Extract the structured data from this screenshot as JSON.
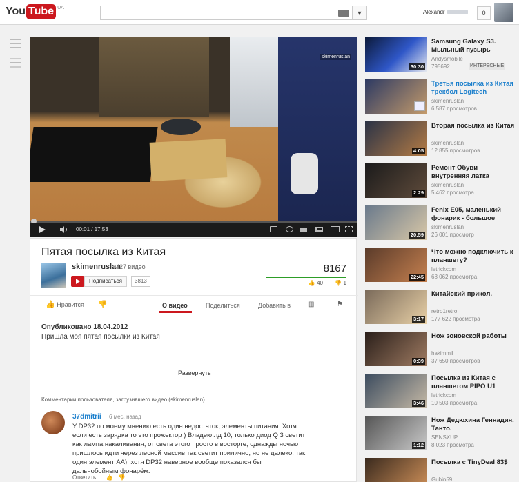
{
  "header": {
    "logo_you": "You",
    "logo_tube": "Tube",
    "logo_region": "UA",
    "search_placeholder": "",
    "user_name": "Alexandr",
    "notifications": "0"
  },
  "player": {
    "watermark": "skimenruslan",
    "time": "00:01 / 17:53",
    "progress_fraction": 0.001
  },
  "video": {
    "title": "Пятая посылка из Китая",
    "channel": "skimenruslan",
    "channel_videos": "427 видео",
    "subscribe_label": "Подписаться",
    "subscribers": "3813",
    "views": "8167",
    "likes": "40",
    "dislikes": "1",
    "actions": {
      "like": "Нравится",
      "about": "О видео",
      "share": "Поделиться",
      "add": "Добавить в"
    },
    "published": "Опубликовано 18.04.2012",
    "description": "Пришла моя пятая посылки из Китая",
    "expand": "Развернуть",
    "comments_header": "Комментарии пользователя, загрузившего видео (skimenruslan)",
    "comment": {
      "author": "37dmitrii",
      "time": "6 мес. назад",
      "text": "У DP32 по моему мнению есть один недостаток, элементы питания. Хотя если есть зарядка то это прожектор ) Владею лд 10, только диод Q 3 светит как лампа накаливания, от света этого просто в восторге, однажды ночью пришлось идти через лесной массив так светит прилично, но не далеко, так один элемент AA), хотя DP32 наверное вообще показался бы дальнобойным фонарём.",
      "reply": "Ответить"
    }
  },
  "related": [
    {
      "title": "Samsung Galaxy S3. Мыльный пузырь",
      "channel": "Andysmobile",
      "views": "795692",
      "duration": "30:30",
      "tag": "ИНТЕРЕСНЫЕ",
      "highlight": false
    },
    {
      "title": "Третья посылка из Китая трекбол Logitech",
      "channel": "skimenruslan",
      "views": "6 587 просмотров",
      "duration": "",
      "highlight": true
    },
    {
      "title": "Вторая посылка из Китая",
      "channel": "skimenruslan",
      "views": "12 855 просмотров",
      "duration": "4:05",
      "highlight": false
    },
    {
      "title": "Ремонт Обуви внутренняя латка",
      "channel": "skimenruslan",
      "views": "5 462 просмотра",
      "duration": "2:29",
      "highlight": false
    },
    {
      "title": "Fenix E05, маленький фонарик - большое",
      "channel": "skimenruslan",
      "views": "26 001 просмотр",
      "duration": "20:59",
      "highlight": false
    },
    {
      "title": "Что можно подключить к планшету?",
      "channel": "letrickcom",
      "views": "68 062 просмотра",
      "duration": "22:45",
      "highlight": false
    },
    {
      "title": "Китайский прикол.",
      "channel": "retro1retro",
      "views": "177 622 просмотра",
      "duration": "3:17",
      "highlight": false
    },
    {
      "title": "Нож зоновской работы",
      "channel": "hakimmil",
      "views": "37 650 просмотров",
      "duration": "0:39",
      "highlight": false
    },
    {
      "title": "Посылка из Китая с планшетом PIPO U1",
      "channel": "letrickcom",
      "views": "10 503 просмотра",
      "duration": "3:46",
      "highlight": false
    },
    {
      "title": "Нож Дедюхина Геннадия. Танто.",
      "channel": "SENSXUP",
      "views": "8 023 просмотра",
      "duration": "1:12",
      "highlight": false
    },
    {
      "title": "Посылка с TinyDeal 83$",
      "channel": "Gubin59",
      "views": "",
      "duration": "",
      "highlight": false
    }
  ]
}
